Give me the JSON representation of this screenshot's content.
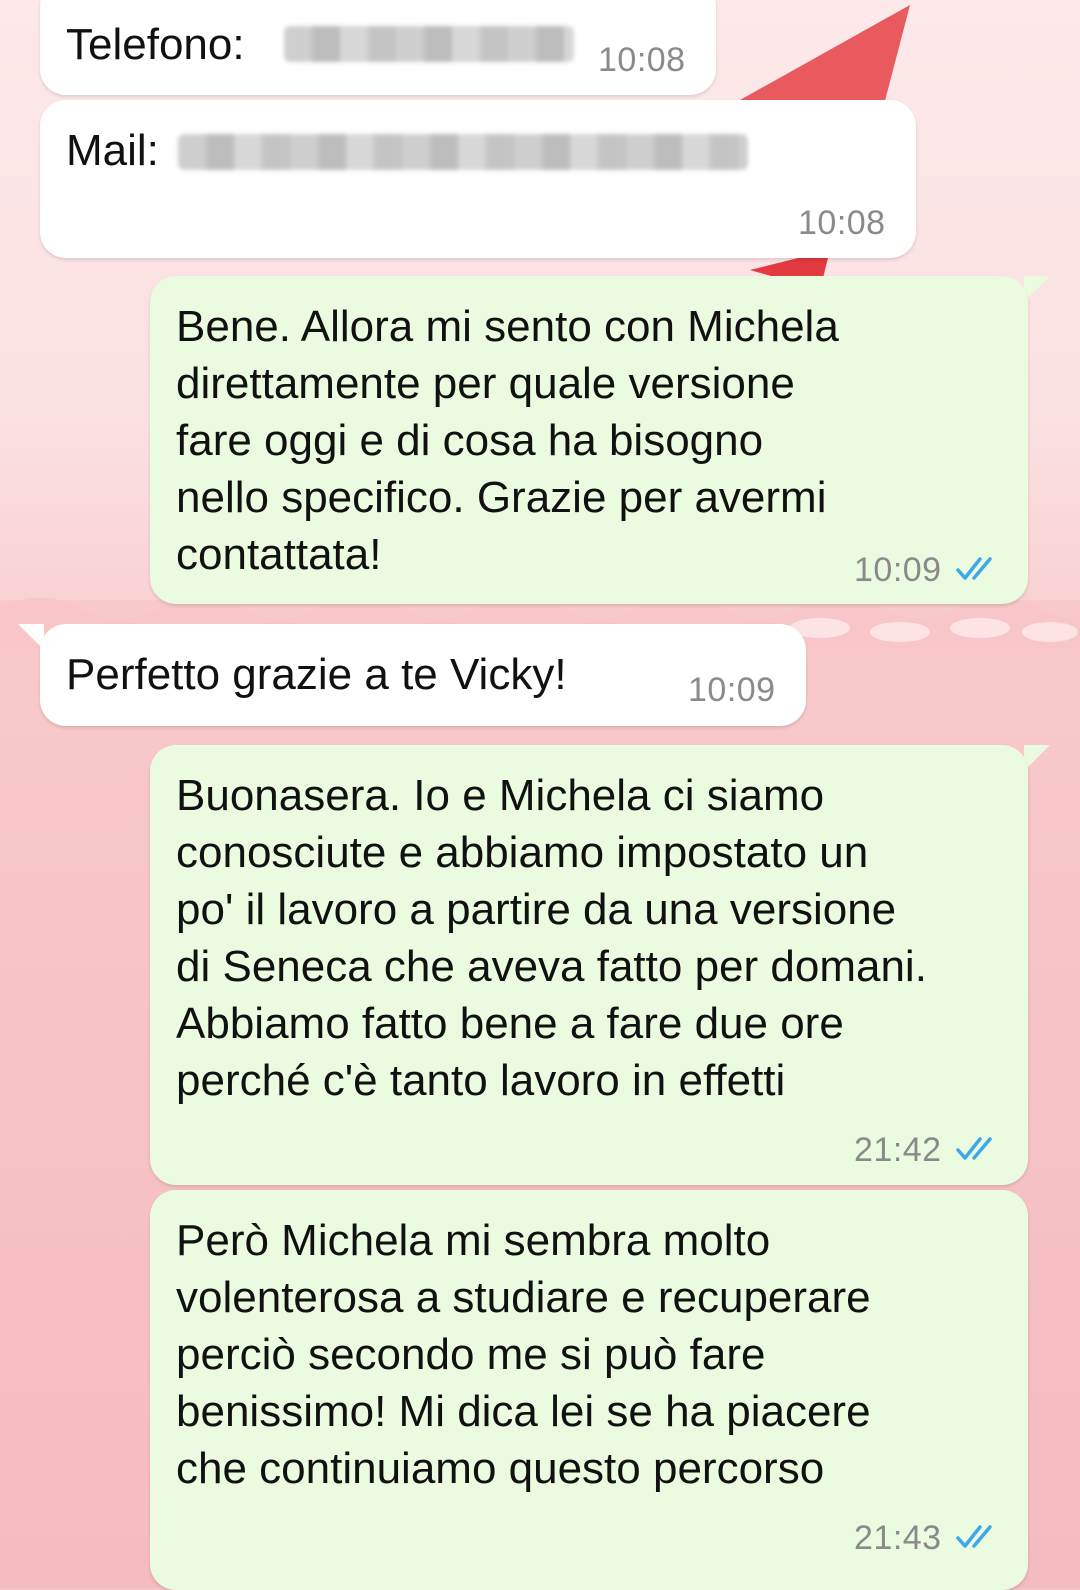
{
  "colors": {
    "incoming_bubble": "#ffffff",
    "outgoing_bubble": "#ebfbdf",
    "read_ticks": "#3ea8e8",
    "timestamp": "#8a8a8a",
    "wallpaper": "#f6c2c4"
  },
  "messages": [
    {
      "direction": "incoming",
      "label": "Telefono:",
      "value_redacted": true,
      "time": "10:08"
    },
    {
      "direction": "incoming",
      "label": "Mail:",
      "value_redacted": true,
      "time": "10:08"
    },
    {
      "direction": "outgoing",
      "text": "Bene. Allora mi sento con Michela\ndirettamente per quale versione\nfare oggi e di cosa ha bisogno\nnello specifico. Grazie per avermi\ncontattata!",
      "time": "10:09",
      "status_icon": "double-check-read-icon"
    },
    {
      "direction": "incoming",
      "text": "Perfetto grazie a te Vicky!",
      "time": "10:09"
    },
    {
      "direction": "outgoing",
      "text": "Buonasera. Io e Michela ci siamo\nconosciute e abbiamo impostato un\npo' il lavoro a partire da una versione\ndi Seneca che aveva fatto per domani.\nAbbiamo fatto bene a fare due ore\nperché c'è tanto lavoro in effetti",
      "time": "21:42",
      "status_icon": "double-check-read-icon"
    },
    {
      "direction": "outgoing",
      "text": "Però Michela mi sembra molto\nvolenterosa a studiare e recuperare\nperciò secondo me si può fare\nbenissimo! Mi dica lei se ha piacere\nche continuiamo questo percorso",
      "time": "21:43",
      "status_icon": "double-check-read-icon"
    }
  ]
}
